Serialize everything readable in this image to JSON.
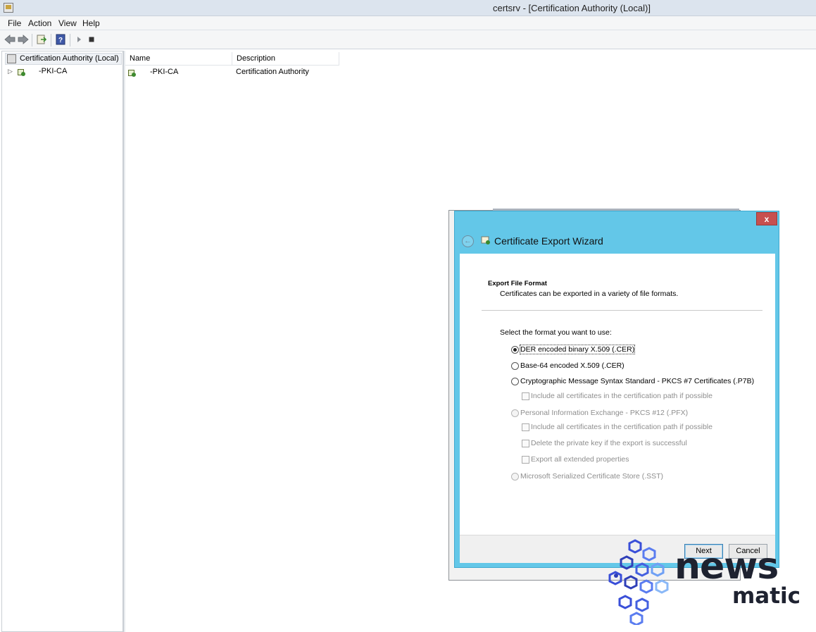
{
  "window": {
    "title": "certsrv - [Certification Authority (Local)]"
  },
  "menu": {
    "items": [
      "File",
      "Action",
      "View",
      "Help"
    ]
  },
  "toolbar": {
    "icons": [
      "back-arrow-icon",
      "forward-arrow-icon",
      "export-list-icon",
      "help-icon",
      "start-service-icon",
      "stop-service-icon"
    ]
  },
  "tree": {
    "root_label": "Certification Authority (Local)",
    "child_label": "-PKI-CA"
  },
  "list": {
    "columns": [
      "Name",
      "Description"
    ],
    "rows": [
      {
        "name": "-PKI-CA",
        "description": "Certification Authority"
      }
    ]
  },
  "wizard": {
    "title": "Certificate Export Wizard",
    "close_label": "x",
    "heading": "Export File Format",
    "subheading": "Certificates can be exported in a variety of file formats.",
    "prompt": "Select the format you want to use:",
    "options": {
      "der": "DER encoded binary X.509 (.CER)",
      "base64": "Base-64 encoded X.509 (.CER)",
      "pkcs7": "Cryptographic Message Syntax Standard - PKCS #7 Certificates (.P7B)",
      "pkcs7_include": "Include all certificates in the certification path if possible",
      "pfx": "Personal Information Exchange - PKCS #12 (.PFX)",
      "pfx_include": "Include all certificates in the certification path if possible",
      "pfx_delete_key": "Delete the private key if the export is successful",
      "pfx_export_ext": "Export all extended properties",
      "sst": "Microsoft Serialized Certificate Store (.SST)"
    },
    "selected_option": "der",
    "next_label": "Next",
    "cancel_label": "Cancel"
  },
  "watermark": {
    "line1": "news",
    "line2": "matic"
  },
  "colors": {
    "wizard_frame": "#63c7e8",
    "close_button": "#c7504f",
    "logo_accent": "#3a4fd8"
  }
}
